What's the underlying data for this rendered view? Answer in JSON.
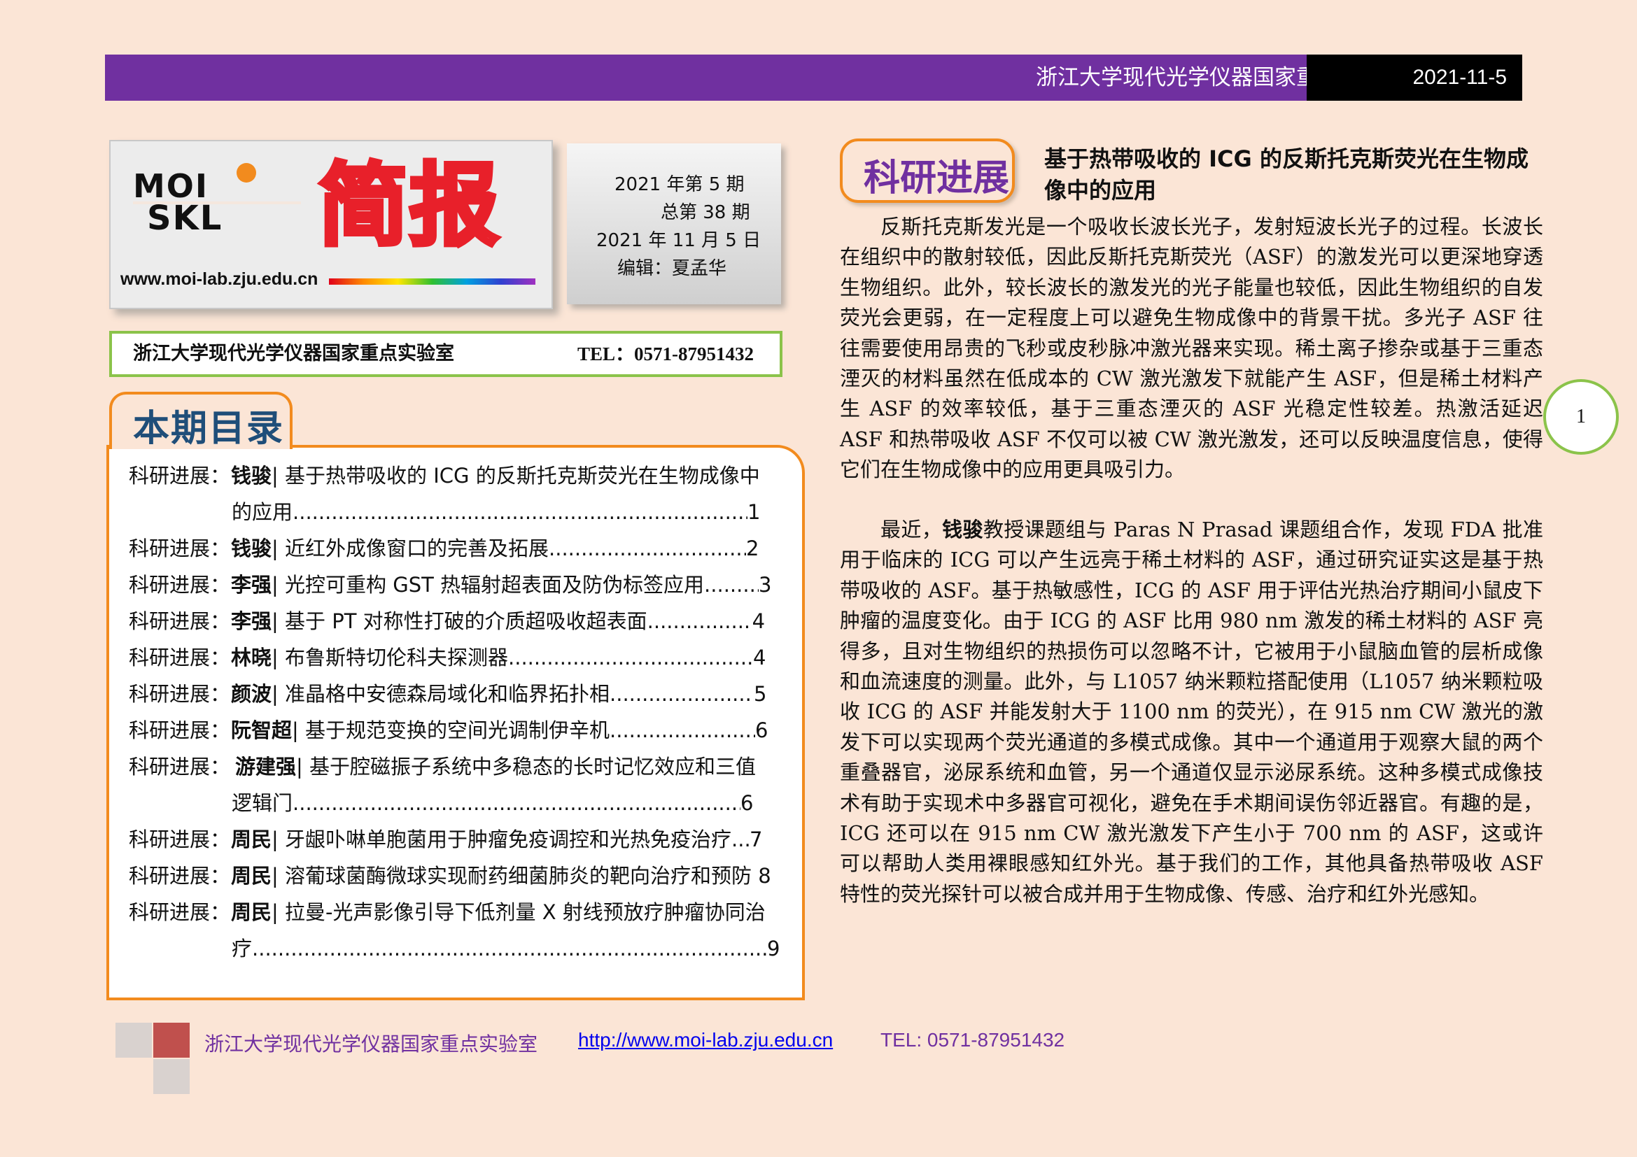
{
  "header": {
    "title": "浙江大学现代光学仪器国家重点实验室简报",
    "date": "2021-11-5"
  },
  "masthead": {
    "logo_text": "MOI SKL",
    "title_big": "简报",
    "url": "www.moi-lab.zju.edu.cn",
    "issue_lines": [
      "2021 年第 5  期",
      "总第 38 期",
      "2021 年 11 月 5 日",
      "编辑：夏孟华"
    ]
  },
  "lab_bar": {
    "name": "浙江大学现代光学仪器国家重点实验室",
    "tel": "TEL：0571-87951432"
  },
  "toc": {
    "heading": "本期目录",
    "items": [
      {
        "category": "科研进展：",
        "author": "钱骏",
        "title": "| 基于热带吸收的 ICG 的反斯托克斯荧光在生物成像中",
        "cont": "的应用",
        "page": "1"
      },
      {
        "category": "科研进展：",
        "author": "钱骏",
        "title": "| 近红外成像窗口的完善及拓展",
        "page": "2"
      },
      {
        "category": "科研进展：",
        "author": "李强",
        "title": "| 光控可重构 GST 热辐射超表面及防伪标签应用",
        "page": "3"
      },
      {
        "category": "科研进展：",
        "author": "李强",
        "title": "| 基于 PT 对称性打破的介质超吸收超表面",
        "page": "4"
      },
      {
        "category": "科研进展：",
        "author": "林晓",
        "title": "| 布鲁斯特切伦科夫探测器",
        "page": "4"
      },
      {
        "category": "科研进展：",
        "author": "颜波",
        "title": "| 准晶格中安德森局域化和临界拓扑相",
        "page": "5"
      },
      {
        "category": "科研进展：",
        "author": "阮智超",
        "title": "| 基于规范变换的空间光调制伊辛机",
        "page": "6"
      },
      {
        "category": "科研进展：",
        "author": "游建强",
        "title": "| 基于腔磁振子系统中多稳态的长时记忆效应和三值",
        "cont": "逻辑门",
        "page": "6"
      },
      {
        "category": "科研进展：",
        "author": "周民",
        "title": "| 牙龈卟啉单胞菌用于肿瘤免疫调控和光热免疫治疗",
        "page": "7"
      },
      {
        "category": "科研进展：",
        "author": "周民",
        "title": "| 溶葡球菌酶微球实现耐药细菌肺炎的靶向治疗和预防 8",
        "page": ""
      },
      {
        "category": "科研进展：",
        "author": "周民",
        "title": "| 拉曼-光声影像引导下低剂量 X 射线预放疗肿瘤协同治",
        "cont": "疗",
        "page": "9"
      }
    ]
  },
  "article": {
    "section": "科研进展",
    "title": "基于热带吸收的 ICG 的反斯托克斯荧光在生物成像中的应用",
    "p1": "反斯托克斯发光是一个吸收长波长光子，发射短波长光子的过程。长波长在组织中的散射较低，因此反斯托克斯荧光（ASF）的激发光可以更深地穿透生物组织。此外，较长波长的激发光的光子能量也较低，因此生物组织的自发荧光会更弱，在一定程度上可以避免生物成像中的背景干扰。多光子 ASF 往往需要使用昂贵的飞秒或皮秒脉冲激光器来实现。稀土离子掺杂或基于三重态湮灭的材料虽然在低成本的 CW 激光激发下就能产生 ASF，但是稀土材料产生 ASF 的效率较低，基于三重态湮灭的 ASF 光稳定性较差。热激活延迟 ASF 和热带吸收 ASF 不仅可以被 CW 激光激发，还可以反映温度信息，使得它们在生物成像中的应用更具吸引力。",
    "p2_pre": "最近，",
    "p2_name": "钱骏",
    "p2_post": "教授课题组与 Paras N Prasad 课题组合作，发现 FDA 批准用于临床的 ICG 可以产生远亮于稀土材料的 ASF，通过研究证实这是基于热带吸收的 ASF。基于热敏感性，ICG 的 ASF 用于评估光热治疗期间小鼠皮下肿瘤的温度变化。由于 ICG 的 ASF 比用 980 nm 激发的稀土材料的 ASF 亮得多，且对生物组织的热损伤可以忽略不计，它被用于小鼠脑血管的层析成像和血流速度的测量。此外，与 L1057 纳米颗粒搭配使用（L1057 纳米颗粒吸收 ICG 的 ASF 并能发射大于 1100 nm 的荧光），在 915 nm CW 激光的激发下可以实现两个荧光通道的多模式成像。其中一个通道用于观察大鼠的两个重叠器官，泌尿系统和血管，另一个通道仅显示泌尿系统。这种多模式成像技术有助于实现术中多器官可视化，避免在手术期间误伤邻近器官。有趣的是，ICG 还可以在 915 nm CW 激光激发下产生小于 700 nm 的 ASF，这或许可以帮助人类用裸眼感知红外光。基于我们的工作，其他具备热带吸收 ASF 特性的荧光探针可以被合成并用于生物成像、传感、治疗和红外光感知。"
  },
  "page_number": "1",
  "footer": {
    "lab": "浙江大学现代光学仪器国家重点实验室",
    "url": "http://www.moi-lab.zju.edu.cn",
    "tel": "TEL: 0571-87951432"
  },
  "colors": {
    "purple": "#7030a0",
    "orange": "#f28b1e",
    "green": "#8bc34a",
    "page_bg": "#fbe5d6",
    "logo_red": "#e8202a"
  }
}
